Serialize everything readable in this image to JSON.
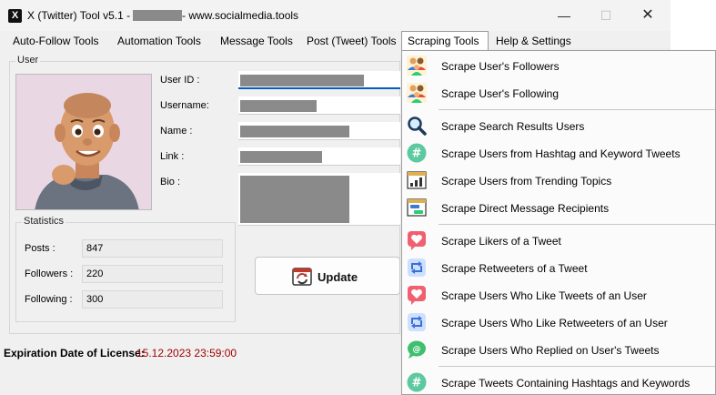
{
  "titlebar": {
    "logo": "X",
    "title_prefix": "X (Twitter) Tool v5.1 -",
    "title_suffix": "- www.socialmedia.tools",
    "minimize": "—",
    "maximize": "☐",
    "close": "✕"
  },
  "menu": {
    "items": [
      "Auto-Follow Tools",
      "Automation Tools",
      "Message Tools",
      "Post (Tweet) Tools",
      "Scraping Tools",
      "Help & Settings"
    ],
    "active": "Scraping Tools"
  },
  "user": {
    "group_title": "User",
    "labels": {
      "user_id": "User ID :",
      "username": "Username:",
      "name": "Name :",
      "link": "Link :",
      "bio": "Bio :"
    }
  },
  "statistics": {
    "group_title": "Statistics",
    "posts_label": "Posts :",
    "posts_value": "847",
    "followers_label": "Followers :",
    "followers_value": "220",
    "following_label": "Following :",
    "following_value": "300"
  },
  "update_button": {
    "label": "Update"
  },
  "license": {
    "label": "Expiration Date of License:",
    "date": "15.12.2023 23:59:00",
    "date_color": "#a00000"
  },
  "dropdown": {
    "items": [
      {
        "label": "Scrape User's Followers",
        "icon": "users-group-icon"
      },
      {
        "label": "Scrape User's Following",
        "icon": "users-group-icon"
      },
      {
        "label": "Scrape Search Results Users",
        "icon": "magnifier-icon"
      },
      {
        "label": "Scrape Users from Hashtag and Keyword Tweets",
        "icon": "hashtag-icon"
      },
      {
        "label": "Scrape Users from Trending Topics",
        "icon": "trending-chart-icon"
      },
      {
        "label": "Scrape Direct Message Recipients",
        "icon": "direct-message-icon"
      },
      {
        "label": "Scrape Likers of a Tweet",
        "icon": "heart-icon"
      },
      {
        "label": "Scrape Retweeters of a Tweet",
        "icon": "retweet-icon"
      },
      {
        "label": "Scrape Users Who Like Tweets of an User",
        "icon": "heart-icon"
      },
      {
        "label": "Scrape Users Who Like Retweeters of an User",
        "icon": "retweet-icon"
      },
      {
        "label": "Scrape Users Who Replied on User's Tweets",
        "icon": "reply-at-icon"
      },
      {
        "label": "Scrape Tweets Containing Hashtags and Keywords",
        "icon": "hashtag-icon"
      }
    ]
  }
}
